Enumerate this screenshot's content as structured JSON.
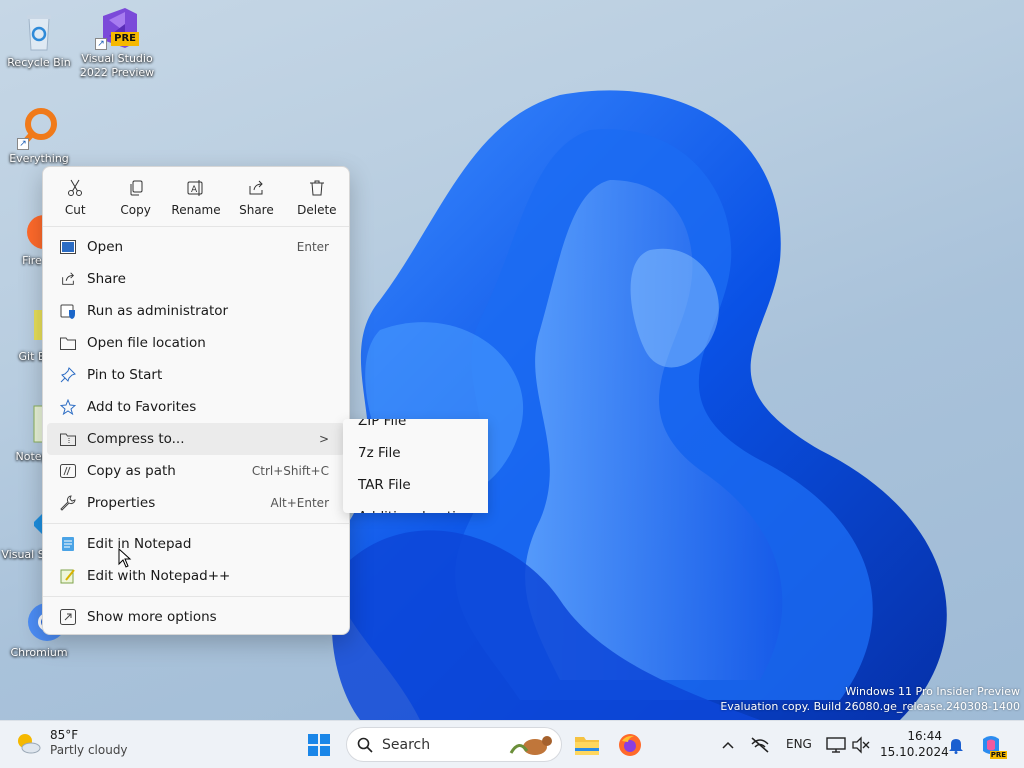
{
  "desktop": {
    "icons": [
      {
        "label": "Recycle Bin"
      },
      {
        "label": "Visual Studio 2022 Preview",
        "badge": "PRE"
      },
      {
        "label": "Everything"
      },
      {
        "label": "Fire"
      },
      {
        "label": "Git B"
      },
      {
        "label": "Notep"
      },
      {
        "label": "Visual S Co"
      },
      {
        "label": "Chromium"
      }
    ],
    "watermark": {
      "line1": "Windows 11 Pro Insider Preview",
      "line2": "Evaluation copy. Build 26080.ge_release.240308-1400"
    }
  },
  "context_menu": {
    "quick_actions": [
      {
        "label": "Cut",
        "icon": "scissors-icon"
      },
      {
        "label": "Copy",
        "icon": "copy-icon"
      },
      {
        "label": "Rename",
        "icon": "rename-icon"
      },
      {
        "label": "Share",
        "icon": "share-icon"
      },
      {
        "label": "Delete",
        "icon": "trash-icon"
      }
    ],
    "items": [
      {
        "label": "Open",
        "shortcut": "Enter",
        "icon": "open-icon"
      },
      {
        "label": "Share",
        "shortcut": "",
        "icon": "share-icon"
      },
      {
        "label": "Run as administrator",
        "shortcut": "",
        "icon": "shield-icon"
      },
      {
        "label": "Open file location",
        "shortcut": "",
        "icon": "folder-icon"
      },
      {
        "label": "Pin to Start",
        "shortcut": "",
        "icon": "pin-icon"
      },
      {
        "label": "Add to Favorites",
        "shortcut": "",
        "icon": "star-icon"
      },
      {
        "label": "Compress to...",
        "shortcut": "",
        "icon": "archive-icon",
        "submenu_arrow": ">"
      },
      {
        "label": "Copy as path",
        "shortcut": "Ctrl+Shift+C",
        "icon": "path-icon"
      },
      {
        "label": "Properties",
        "shortcut": "Alt+Enter",
        "icon": "wrench-icon"
      },
      {
        "label": "Edit in Notepad",
        "shortcut": "",
        "icon": "notepad-icon"
      },
      {
        "label": "Edit with Notepad++",
        "shortcut": "",
        "icon": "notepadpp-icon"
      },
      {
        "label": "Show more options",
        "shortcut": "",
        "icon": "more-options-icon"
      }
    ]
  },
  "compress_submenu": {
    "items": [
      "ZIP File",
      "7z File",
      "TAR File",
      "Additional options"
    ]
  },
  "taskbar": {
    "weather": {
      "temp": "85°F",
      "condition": "Partly cloudy"
    },
    "search_label": "Search",
    "language": "ENG",
    "time": "16:44",
    "date": "15.10.2024"
  },
  "colors": {
    "accent": "#0067c0",
    "menu_bg": "#f9f9f9",
    "hover": "#ebebeb",
    "taskbar_bg": "#eef2f7"
  }
}
